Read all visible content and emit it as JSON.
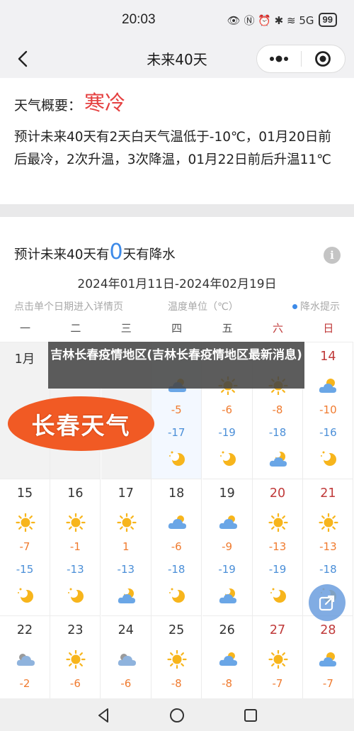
{
  "status_bar": {
    "time": "20:03",
    "icons": "👁 Ⓝ ⏰ ✱ ≋ 5G",
    "battery": "99"
  },
  "nav": {
    "title": "未来40天"
  },
  "summary": {
    "label": "天气概要：",
    "type": "寒冷",
    "text": "预计未来40天有2天白天气温低于-10℃，01月20日前后最冷，2次升温，3次降温，01月22日前后升温11℃"
  },
  "rain": {
    "prefix": "预计未来40天有",
    "days": "0",
    "suffix": "天有降水"
  },
  "date_range": "2024年01月11日-2024年02月19日",
  "hints": {
    "left": "点击单个日期进入详情页",
    "middle": "温度单位（℃）",
    "right": "降水提示"
  },
  "weekdays": [
    "一",
    "二",
    "三",
    "四",
    "五",
    "六",
    "日"
  ],
  "month_label": "1月",
  "days": [
    {
      "date": "1月",
      "high": "",
      "low": "",
      "day_icon": "",
      "night_icon": ""
    },
    {
      "date": "",
      "high": "",
      "low": "",
      "day_icon": "",
      "night_icon": ""
    },
    {
      "date": "",
      "high": "",
      "low": "",
      "day_icon": "",
      "night_icon": ""
    },
    {
      "date": "",
      "high": "-5",
      "low": "-17",
      "day_icon": "cloud",
      "night_icon": "moon"
    },
    {
      "date": "",
      "high": "-6",
      "low": "-19",
      "day_icon": "sun",
      "night_icon": "moon"
    },
    {
      "date": "",
      "high": "-8",
      "low": "-18",
      "day_icon": "sun",
      "night_icon": "moon-cloud"
    },
    {
      "date": "14",
      "high": "-10",
      "low": "-16",
      "day_icon": "sun-cloud",
      "night_icon": "moon"
    },
    {
      "date": "15",
      "high": "-7",
      "low": "-15",
      "day_icon": "sun",
      "night_icon": "moon"
    },
    {
      "date": "16",
      "high": "-1",
      "low": "-13",
      "day_icon": "sun",
      "night_icon": "moon"
    },
    {
      "date": "17",
      "high": "1",
      "low": "-13",
      "day_icon": "sun",
      "night_icon": "moon-cloud"
    },
    {
      "date": "18",
      "high": "-6",
      "low": "-18",
      "day_icon": "cloud",
      "night_icon": "moon"
    },
    {
      "date": "19",
      "high": "-9",
      "low": "-19",
      "day_icon": "cloud",
      "night_icon": "moon-cloud"
    },
    {
      "date": "20",
      "high": "-13",
      "low": "-19",
      "day_icon": "sun",
      "night_icon": "moon"
    },
    {
      "date": "21",
      "high": "-13",
      "low": "-18",
      "day_icon": "sun",
      "night_icon": "moon"
    },
    {
      "date": "22",
      "high": "-2",
      "low": "",
      "day_icon": "cloud-dark",
      "night_icon": ""
    },
    {
      "date": "23",
      "high": "-6",
      "low": "",
      "day_icon": "sun",
      "night_icon": ""
    },
    {
      "date": "24",
      "high": "-6",
      "low": "",
      "day_icon": "cloud-dark",
      "night_icon": ""
    },
    {
      "date": "25",
      "high": "-8",
      "low": "",
      "day_icon": "sun",
      "night_icon": ""
    },
    {
      "date": "26",
      "high": "-8",
      "low": "",
      "day_icon": "cloud",
      "night_icon": ""
    },
    {
      "date": "27",
      "high": "-7",
      "low": "",
      "day_icon": "sun",
      "night_icon": ""
    },
    {
      "date": "28",
      "high": "-7",
      "low": "",
      "day_icon": "sun-cloud",
      "night_icon": ""
    }
  ],
  "overlay": {
    "title": "吉林长春疫情地区(吉林长春疫情地区最新消息)"
  },
  "logo": {
    "text": "长春天气"
  },
  "colors": {
    "high": "#f07b2f",
    "low": "#4b8fd8",
    "weekend": "#c03a3a",
    "rain_accent": "#3d8ae8",
    "logo": "#f15a24"
  }
}
